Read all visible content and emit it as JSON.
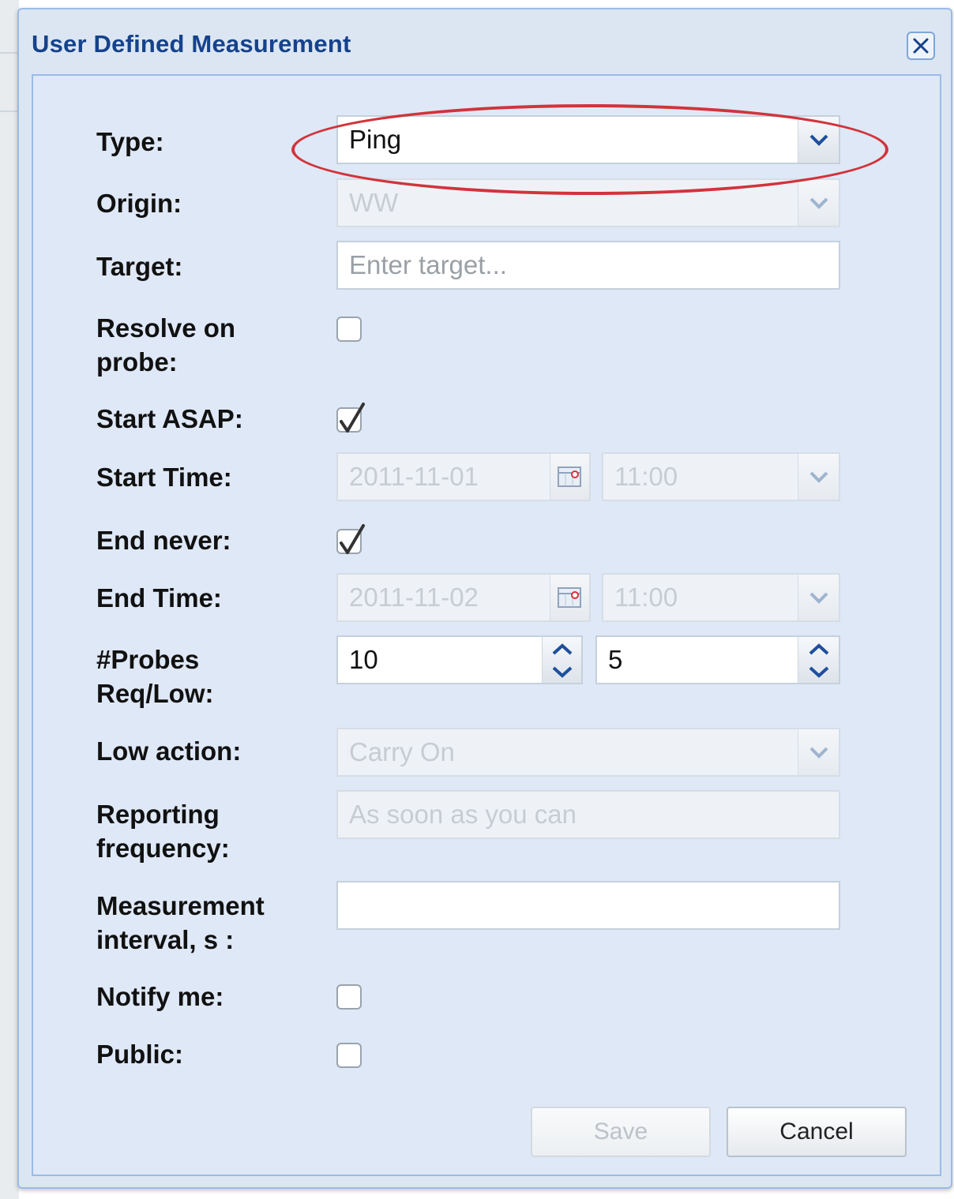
{
  "window": {
    "title": "User Defined Measurement"
  },
  "form": {
    "type": {
      "label": "Type:",
      "value": "Ping"
    },
    "origin": {
      "label": "Origin:",
      "value": "WW"
    },
    "target": {
      "label": "Target:",
      "placeholder": "Enter target..."
    },
    "resolve_on_probe": {
      "label_line1": "Resolve on",
      "label_line2": "probe:",
      "checked": false
    },
    "start_asap": {
      "label": "Start ASAP:",
      "checked": true
    },
    "start_time": {
      "label": "Start Time:",
      "date": "2011-11-01",
      "time": "11:00"
    },
    "end_never": {
      "label": "End never:",
      "checked": true
    },
    "end_time": {
      "label": "End Time:",
      "date": "2011-11-02",
      "time": "11:00"
    },
    "probes": {
      "label_line1": "#Probes",
      "label_line2": "Req/Low:",
      "requested": "10",
      "low": "5"
    },
    "low_action": {
      "label": "Low action:",
      "value": "Carry On"
    },
    "reporting_frequency": {
      "label_line1": "Reporting",
      "label_line2": "frequency:",
      "value": "As soon as you can"
    },
    "measurement_interval": {
      "label_line1": "Measurement",
      "label_line2": "interval, s :",
      "value": ""
    },
    "notify_me": {
      "label": "Notify me:",
      "checked": false
    },
    "public": {
      "label": "Public:",
      "checked": false
    }
  },
  "buttons": {
    "save": "Save",
    "cancel": "Cancel"
  },
  "colors": {
    "title": "#15428b",
    "highlight_oval": "#d2333b",
    "panel": "#dfe8f6"
  },
  "icons": [
    "close-icon",
    "chevron-down-icon",
    "calendar-icon",
    "checkmark-icon",
    "spinner-up-icon",
    "spinner-down-icon"
  ]
}
